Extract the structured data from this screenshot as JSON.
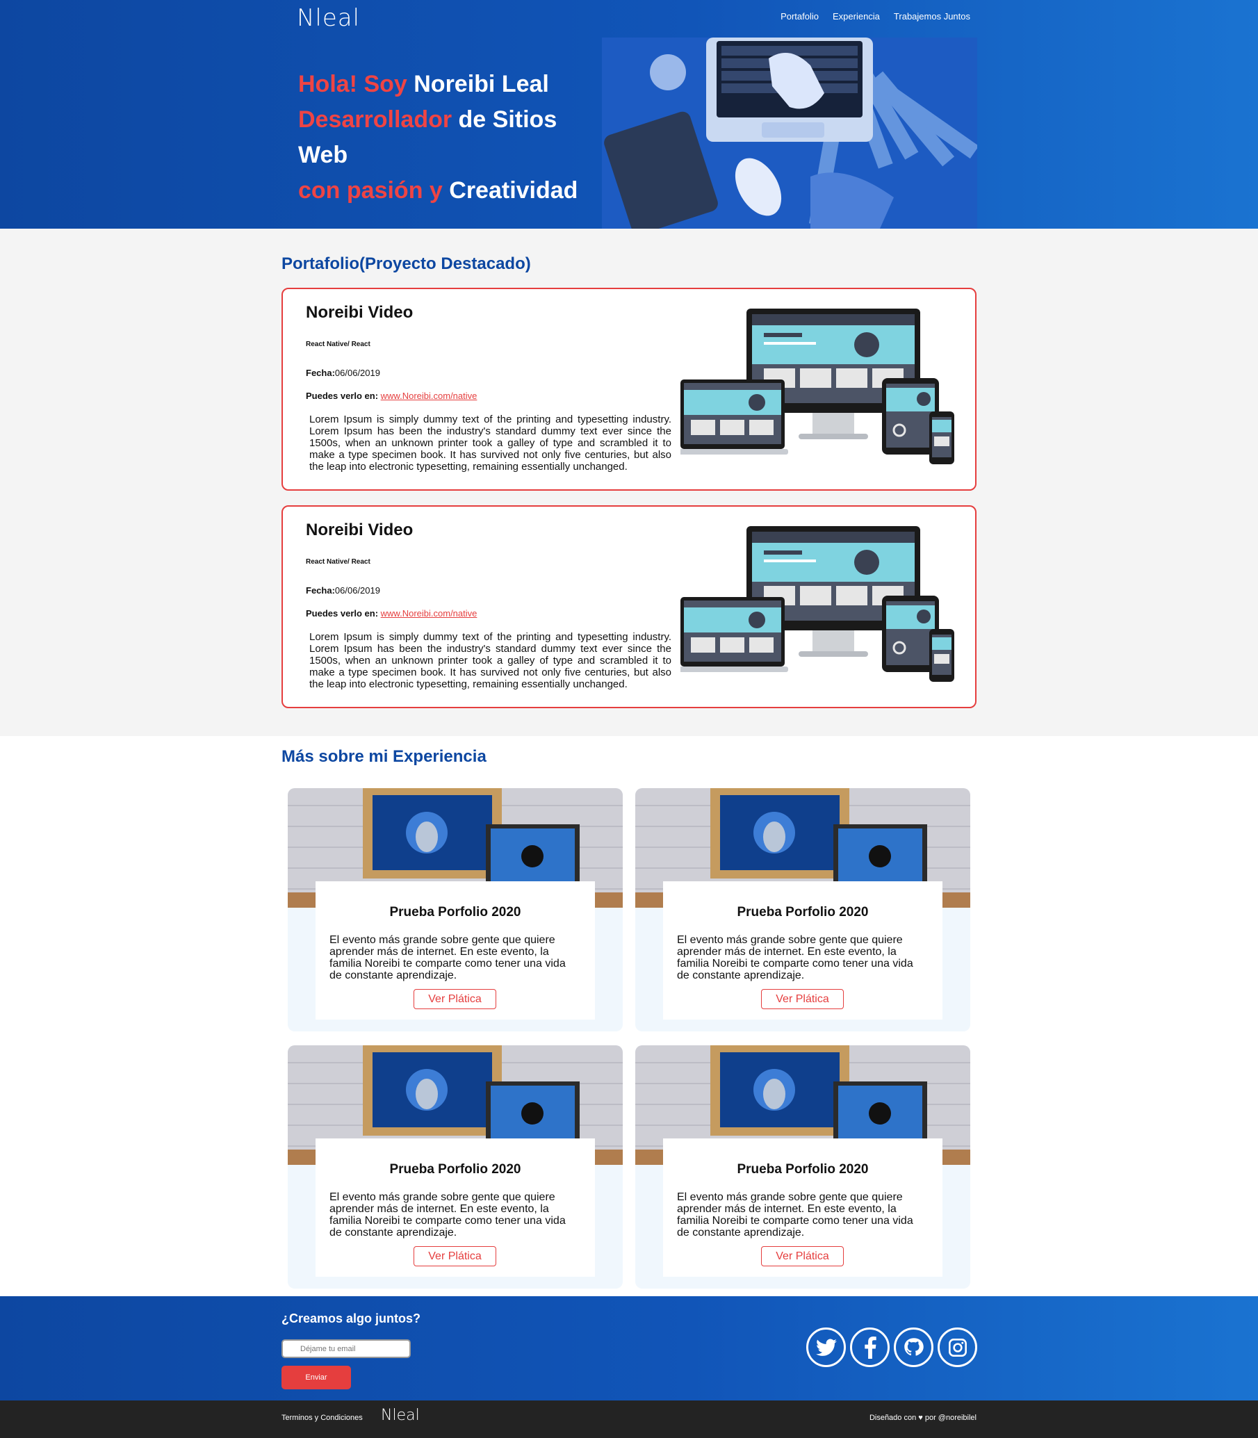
{
  "header": {
    "logo": "Nleal",
    "nav": [
      "Portafolio",
      "Experiencia",
      "Trabajemos Juntos"
    ]
  },
  "hero": {
    "line1_red": "Hola! Soy ",
    "line1_white": "Noreibi Leal",
    "line2_red": "Desarrollador",
    "line2_white": " de Sitios",
    "line3_white": "Web",
    "line4_red": "con pasión y ",
    "line4_white": "Creatividad"
  },
  "portfolio": {
    "title": "Portafolio(Proyecto Destacado)",
    "projects": [
      {
        "name": "Noreibi Video",
        "tech": "React Native/ React",
        "fecha_label": "Fecha:",
        "fecha": "06/06/2019",
        "puedes_label": "Puedes verlo en: ",
        "link": "www.Noreibi.com/native",
        "description": "Lorem Ipsum is simply dummy text of the printing and typesetting industry. Lorem Ipsum has been the industry's standard dummy text ever since the 1500s, when an unknown printer took a galley of type and scrambled it to make a type specimen book. It has survived not only five centuries, but also the leap into electronic typesetting, remaining essentially unchanged."
      },
      {
        "name": "Noreibi Video",
        "tech": "React Native/ React",
        "fecha_label": "Fecha:",
        "fecha": "06/06/2019",
        "puedes_label": "Puedes verlo en: ",
        "link": "www.Noreibi.com/native",
        "description": "Lorem Ipsum is simply dummy text of the printing and typesetting industry. Lorem Ipsum has been the industry's standard dummy text ever since the 1500s, when an unknown printer took a galley of type and scrambled it to make a type specimen book. It has survived not only five centuries, but also the leap into electronic typesetting, remaining essentially unchanged."
      }
    ]
  },
  "experience": {
    "title": "Más sobre mi Experiencia",
    "cards": [
      {
        "title": "Prueba Porfolio 2020",
        "text": "El evento más grande sobre gente que quiere aprender más de internet. En este evento, la familia Noreibi te comparte como tener una vida de constante aprendizaje.",
        "button": "Ver Plática"
      },
      {
        "title": "Prueba Porfolio 2020",
        "text": "El evento más grande sobre gente que quiere aprender más de internet. En este evento, la familia Noreibi te comparte como tener una vida de constante aprendizaje.",
        "button": "Ver Plática"
      },
      {
        "title": "Prueba Porfolio 2020",
        "text": "El evento más grande sobre gente que quiere aprender más de internet. En este evento, la familia Noreibi te comparte como tener una vida de constante aprendizaje.",
        "button": "Ver Plática"
      },
      {
        "title": "Prueba Porfolio 2020",
        "text": "El evento más grande sobre gente que quiere aprender más de internet. En este evento, la familia Noreibi te comparte como tener una vida de constante aprendizaje.",
        "button": "Ver Plática"
      }
    ]
  },
  "contact": {
    "title": "¿Creamos algo juntos?",
    "email_placeholder": "Déjame tu email",
    "send_label": "Enviar",
    "socials": [
      "twitter-icon",
      "facebook-icon",
      "github-icon",
      "instagram-icon"
    ]
  },
  "footer": {
    "terms": "Terminos y Condiciones",
    "logo": "Nleal",
    "credit": "Diseñado con ♥ por @noreibilel"
  },
  "colors": {
    "primary": "#0d47a1",
    "accent": "#e53e3e",
    "footer_bg": "#232323"
  }
}
